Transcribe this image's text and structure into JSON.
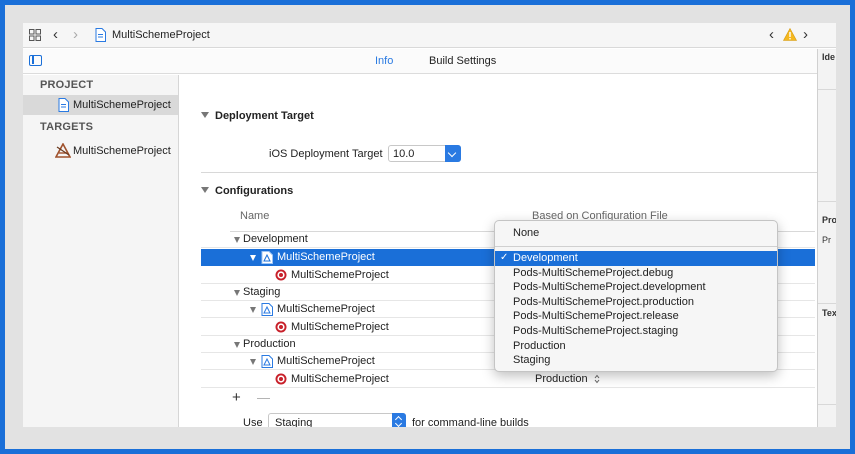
{
  "jumpbar": {
    "breadcrumb": "MultiSchemeProject"
  },
  "tabs": {
    "info": "Info",
    "build_settings": "Build Settings"
  },
  "sidebar": {
    "project_header": "PROJECT",
    "project_item": "MultiSchemeProject",
    "targets_header": "TARGETS",
    "target_item": "MultiSchemeProject"
  },
  "inspector": {
    "label1": "Ide",
    "label2": "Pro",
    "label3": "Pr",
    "label4": "Tex"
  },
  "deployment": {
    "title": "Deployment Target",
    "ios_label": "iOS Deployment Target",
    "ios_value": "10.0"
  },
  "configurations": {
    "title": "Configurations",
    "col_name": "Name",
    "col_based_on": "Based on Configuration File",
    "groups": [
      {
        "name": "Development",
        "project": "MultiSchemeProject",
        "target": "MultiSchemeProject"
      },
      {
        "name": "Staging",
        "project": "MultiSchemeProject",
        "target": "MultiSchemeProject"
      },
      {
        "name": "Production",
        "project": "MultiSchemeProject",
        "target": "MultiSchemeProject",
        "project_config": "Production"
      }
    ]
  },
  "bottom": {
    "add": "+",
    "remove": "—",
    "use_label": "Use",
    "use_value": "Staging",
    "suffix": "for command-line builds"
  },
  "menu": {
    "none": "None",
    "items": [
      "Development",
      "Pods-MultiSchemeProject.debug",
      "Pods-MultiSchemeProject.development",
      "Pods-MultiSchemeProject.production",
      "Pods-MultiSchemeProject.release",
      "Pods-MultiSchemeProject.staging",
      "Production",
      "Staging"
    ],
    "selected": "Development",
    "check": "✓"
  },
  "colors": {
    "accent": "#1a6fd8",
    "frame": "#1a6fd8",
    "target_icon": "#c8202a"
  }
}
